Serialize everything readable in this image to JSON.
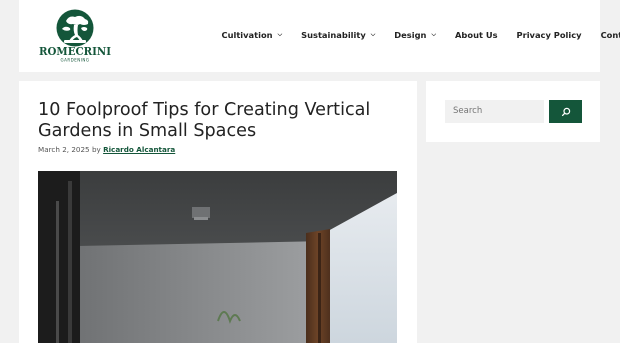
{
  "brand": {
    "logo_text": "ROMECRINI",
    "logo_subtext": "GARDENING",
    "accent": "#14563a"
  },
  "nav": {
    "items": [
      {
        "label": "Cultivation",
        "has_dropdown": true
      },
      {
        "label": "Sustainability",
        "has_dropdown": true
      },
      {
        "label": "Design",
        "has_dropdown": true
      },
      {
        "label": "About Us",
        "has_dropdown": false
      },
      {
        "label": "Privacy Policy",
        "has_dropdown": false
      },
      {
        "label": "Contact Us",
        "has_dropdown": false
      }
    ],
    "dropdown_glyph": "⌄"
  },
  "post": {
    "title": "10 Foolproof Tips for Creating Vertical Gardens in Small Spaces",
    "date": "March 2, 2025",
    "by": "by",
    "author": "Ricardo Alcantara"
  },
  "sidebar": {
    "search_placeholder": "Search"
  }
}
